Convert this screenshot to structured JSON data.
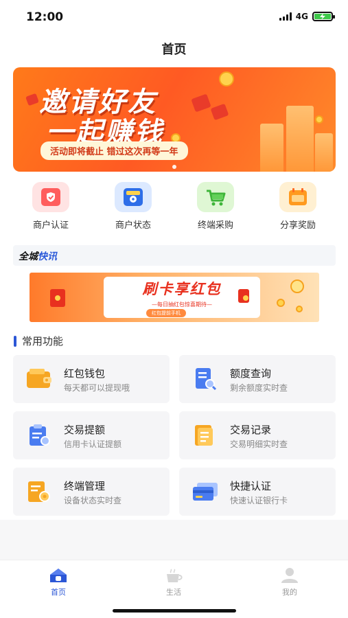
{
  "status_bar": {
    "time": "12:00",
    "network": "4G"
  },
  "header": {
    "title": "首页"
  },
  "banner": {
    "line1": "邀请好友",
    "line2": "一起赚钱",
    "note": "活动即将截止  错过这次再等一年"
  },
  "quick_entries": [
    {
      "label": "商户认证",
      "icon": "merchant-shield-icon"
    },
    {
      "label": "商户状态",
      "icon": "store-icon"
    },
    {
      "label": "终端采购",
      "icon": "cart-icon"
    },
    {
      "label": "分享奖励",
      "icon": "reward-calendar-icon"
    }
  ],
  "news": {
    "title_prefix": "全城",
    "title_highlight": "快讯",
    "banner_title": "刷卡享红包",
    "banner_sub": "—每日抽红包惊喜期待—",
    "banner_tag": "红包提前手机"
  },
  "section": {
    "title": "常用功能"
  },
  "functions": [
    {
      "title": "红包钱包",
      "desc": "每天都可以提现哦",
      "icon": "wallet-icon"
    },
    {
      "title": "额度查询",
      "desc": "剩余额度实时查",
      "icon": "quota-search-icon"
    },
    {
      "title": "交易提额",
      "desc": "信用卡认证提额",
      "icon": "raise-limit-icon"
    },
    {
      "title": "交易记录",
      "desc": "交易明细实时查",
      "icon": "records-icon"
    },
    {
      "title": "终端管理",
      "desc": "设备状态实时查",
      "icon": "terminal-manage-icon"
    },
    {
      "title": "快捷认证",
      "desc": "快速认证银行卡",
      "icon": "bank-card-icon"
    }
  ],
  "tabs": [
    {
      "label": "首页",
      "active": true
    },
    {
      "label": "生活",
      "active": false
    },
    {
      "label": "我的",
      "active": false
    }
  ],
  "colors": {
    "accent": "#2c57d6",
    "banner": "#ff5a23",
    "icon_orange": "#f6a623",
    "icon_blue": "#4a7cf0"
  }
}
